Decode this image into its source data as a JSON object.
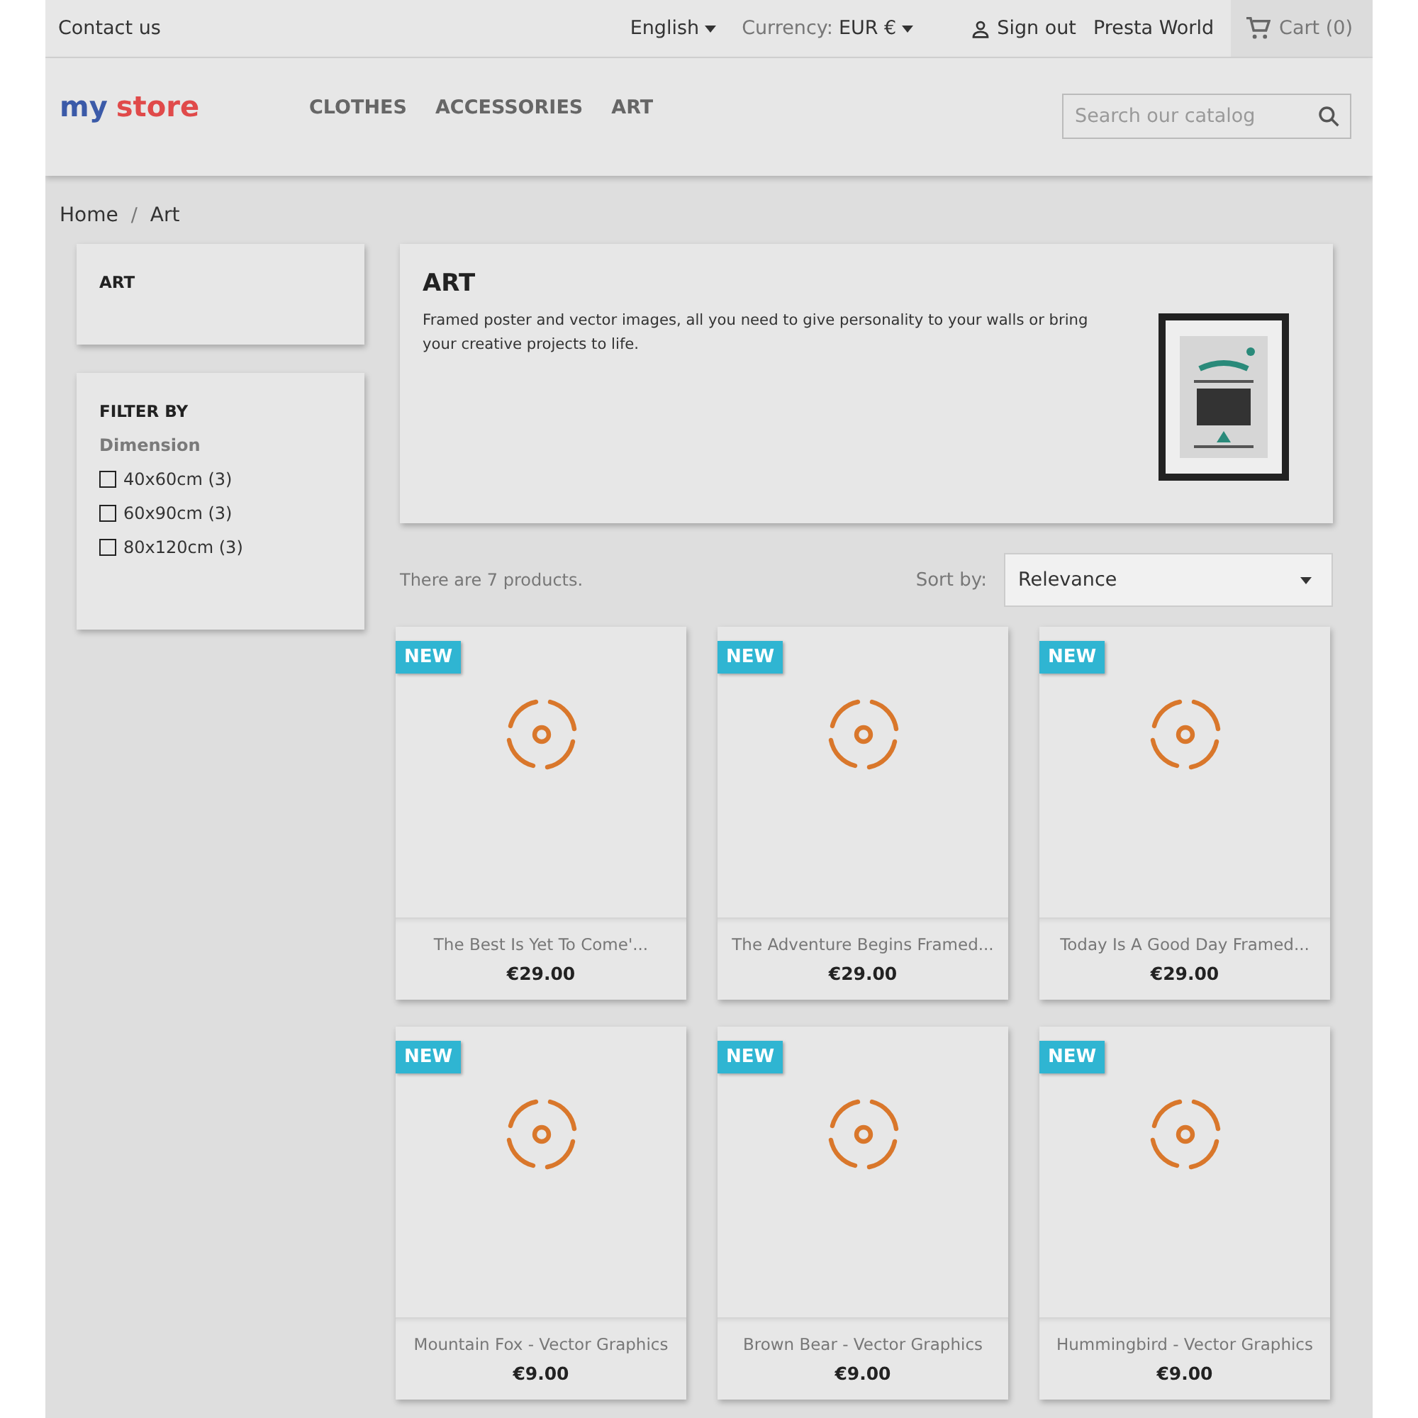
{
  "top_bar": {
    "contact": "Contact us",
    "language": "English",
    "currency_label": "Currency:",
    "currency": "EUR €",
    "sign_out": "Sign out",
    "user": "Presta World",
    "cart": "Cart (0)"
  },
  "header": {
    "logo": {
      "word1": "my",
      "word2": "store"
    },
    "menu": [
      "CLOTHES",
      "ACCESSORIES",
      "ART"
    ],
    "search": {
      "placeholder": "Search our catalog"
    }
  },
  "breadcrumb": {
    "separator": "/",
    "items": [
      "Home",
      "Art"
    ]
  },
  "sidebar": {
    "category": "ART",
    "filter_title": "FILTER BY",
    "facet": "Dimension",
    "options": [
      {
        "label": "40x60cm (3)",
        "checked": false
      },
      {
        "label": "60x90cm (3)",
        "checked": false
      },
      {
        "label": "80x120cm (3)",
        "checked": false
      }
    ]
  },
  "category": {
    "title": "ART",
    "description": "Framed poster and vector images, all you need to give personality to your walls or bring your creative projects to life."
  },
  "listing": {
    "count": "There are 7 products.",
    "sort_label": "Sort by:",
    "sort_value": "Relevance"
  },
  "products": [
    {
      "badge": "NEW",
      "name": "The Best Is Yet To Come'...",
      "price": "€29.00"
    },
    {
      "badge": "NEW",
      "name": "The Adventure Begins Framed...",
      "price": "€29.00"
    },
    {
      "badge": "NEW",
      "name": "Today Is A Good Day Framed...",
      "price": "€29.00"
    },
    {
      "badge": "NEW",
      "name": "Mountain Fox - Vector Graphics",
      "price": "€9.00"
    },
    {
      "badge": "NEW",
      "name": "Brown Bear - Vector Graphics",
      "price": "€9.00"
    },
    {
      "badge": "NEW",
      "name": "Hummingbird - Vector Graphics",
      "price": "€9.00"
    }
  ]
}
